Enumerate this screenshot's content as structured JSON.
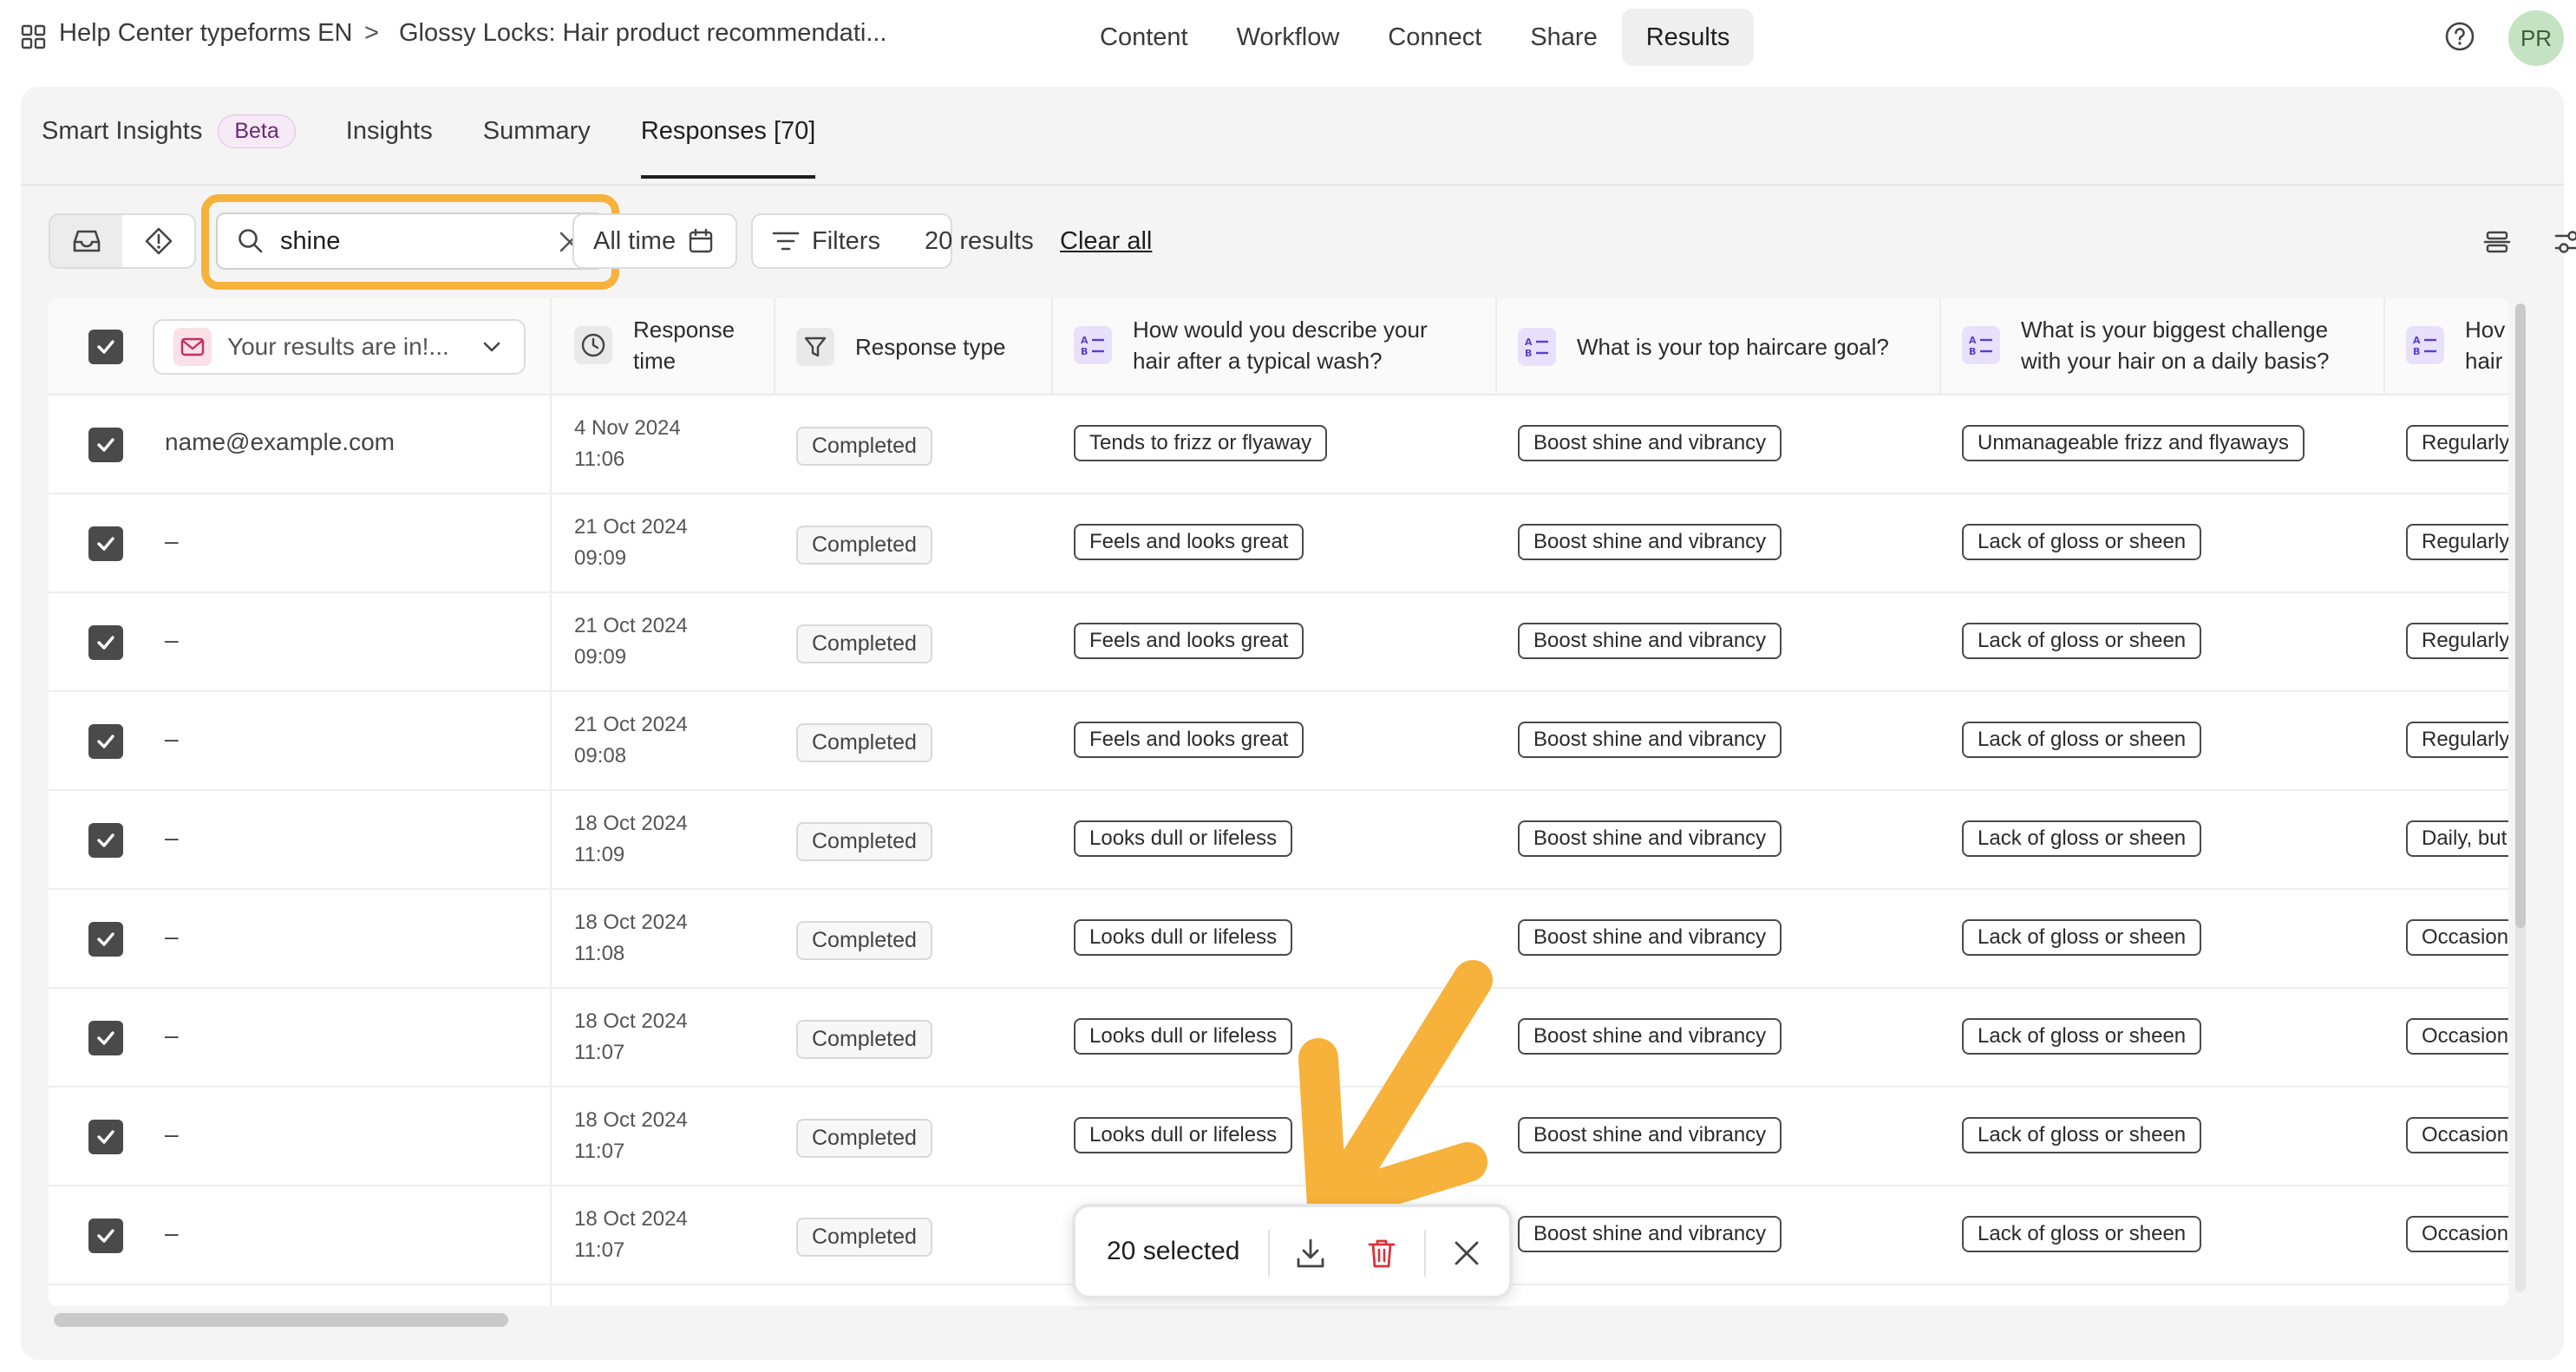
{
  "breadcrumb": {
    "workspace": "Help Center typeforms EN",
    "separator": ">",
    "form": "Glossy Locks: Hair product recommendati..."
  },
  "nav": {
    "items": [
      {
        "label": "Content"
      },
      {
        "label": "Workflow"
      },
      {
        "label": "Connect"
      },
      {
        "label": "Share"
      },
      {
        "label": "Results",
        "active": true
      }
    ]
  },
  "user": {
    "initials": "PR"
  },
  "tabs": {
    "smart_insights": "Smart Insights",
    "beta": "Beta",
    "insights": "Insights",
    "summary": "Summary",
    "responses": "Responses [70]"
  },
  "toolbar": {
    "search_value": "shine",
    "all_time": "All time",
    "filters": "Filters",
    "results_count": "20 results",
    "clear_all": "Clear all"
  },
  "table": {
    "email_column": "Your results are in!...",
    "headers": {
      "response_time": "Response time",
      "response_type": "Response type",
      "q1": "How would you describe your hair after a typical wash?",
      "q2": "What is your top haircare goal?",
      "q3": "What is your biggest challenge with your hair on a daily basis?",
      "q4": "Hov hair"
    },
    "rows": [
      {
        "email": "name@example.com",
        "date": "4 Nov 2024",
        "time": "11:06",
        "status": "Completed",
        "q1": "Tends to frizz or flyaway",
        "q2": "Boost shine and vibrancy",
        "q3": "Unmanageable frizz and flyaways",
        "q4": "Regularly"
      },
      {
        "email": "–",
        "date": "21 Oct 2024",
        "time": "09:09",
        "status": "Completed",
        "q1": "Feels and looks great",
        "q2": "Boost shine and vibrancy",
        "q3": "Lack of gloss or sheen",
        "q4": "Regularly"
      },
      {
        "email": "–",
        "date": "21 Oct 2024",
        "time": "09:09",
        "status": "Completed",
        "q1": "Feels and looks great",
        "q2": "Boost shine and vibrancy",
        "q3": "Lack of gloss or sheen",
        "q4": "Regularly"
      },
      {
        "email": "–",
        "date": "21 Oct 2024",
        "time": "09:08",
        "status": "Completed",
        "q1": "Feels and looks great",
        "q2": "Boost shine and vibrancy",
        "q3": "Lack of gloss or sheen",
        "q4": "Regularly"
      },
      {
        "email": "–",
        "date": "18 Oct 2024",
        "time": "11:09",
        "status": "Completed",
        "q1": "Looks dull or lifeless",
        "q2": "Boost shine and vibrancy",
        "q3": "Lack of gloss or sheen",
        "q4": "Daily, but"
      },
      {
        "email": "–",
        "date": "18 Oct 2024",
        "time": "11:08",
        "status": "Completed",
        "q1": "Looks dull or lifeless",
        "q2": "Boost shine and vibrancy",
        "q3": "Lack of gloss or sheen",
        "q4": "Occasion"
      },
      {
        "email": "–",
        "date": "18 Oct 2024",
        "time": "11:07",
        "status": "Completed",
        "q1": "Looks dull or lifeless",
        "q2": "Boost shine and vibrancy",
        "q3": "Lack of gloss or sheen",
        "q4": "Occasion"
      },
      {
        "email": "–",
        "date": "18 Oct 2024",
        "time": "11:07",
        "status": "Completed",
        "q1": "Looks dull or lifeless",
        "q2": "Boost shine and vibrancy",
        "q3": "Lack of gloss or sheen",
        "q4": "Occasion"
      },
      {
        "email": "–",
        "date": "18 Oct 2024",
        "time": "11:07",
        "status": "Completed",
        "q1": "",
        "q2": "Boost shine and vibrancy",
        "q3": "Lack of gloss or sheen",
        "q4": "Occasion"
      }
    ]
  },
  "selection_bar": {
    "label": "20 selected"
  },
  "colors": {
    "highlight": "#f7b23b",
    "checkbox": "#4a4a4a",
    "beta_text": "#6b2a74",
    "avatar_bg": "#c5e3c2"
  },
  "icons": {
    "apps": "apps-grid-icon",
    "help": "help-circle-icon",
    "inbox": "inbox-icon",
    "alert": "alert-diamond-icon",
    "search": "search-icon",
    "clear": "close-icon",
    "calendar": "calendar-icon",
    "filter": "filter-icon",
    "download": "download-icon",
    "trash": "trash-icon"
  }
}
